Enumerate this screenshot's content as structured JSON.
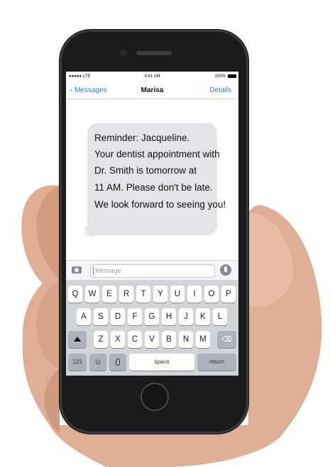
{
  "status_bar": {
    "carrier": "●●●●● LTE",
    "time": "9:41 AM",
    "battery": "100%"
  },
  "nav": {
    "back_label": "Messages",
    "title": "Marisa",
    "details_label": "Details"
  },
  "message": {
    "lines": [
      "Reminder: Jacqueline.",
      "Your dentist appointment with",
      "Dr. Smith is tomorrow at",
      "11 AM. Please don't be late.",
      "We look forward to seeing you!"
    ]
  },
  "input": {
    "placeholder": "Message"
  },
  "keyboard": {
    "row1": [
      "Q",
      "W",
      "E",
      "R",
      "T",
      "Y",
      "U",
      "I",
      "O",
      "P"
    ],
    "row2": [
      "A",
      "S",
      "D",
      "F",
      "G",
      "H",
      "J",
      "K",
      "L"
    ],
    "row3": [
      "Z",
      "X",
      "C",
      "V",
      "B",
      "N",
      "M"
    ],
    "numbers_label": "123",
    "space_label": "space",
    "return_label": "return"
  }
}
